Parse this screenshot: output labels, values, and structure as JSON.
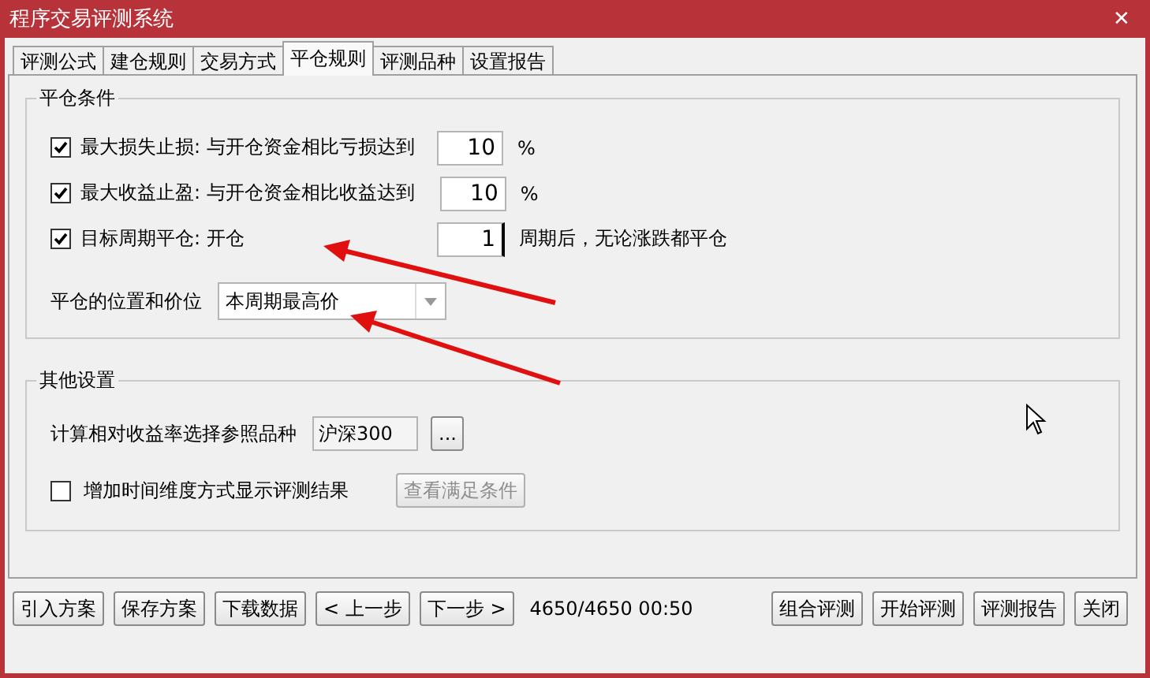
{
  "window": {
    "title": "程序交易评测系统",
    "close": "✕"
  },
  "tabs": [
    {
      "label": "评测公式",
      "selected": false
    },
    {
      "label": "建仓规则",
      "selected": false
    },
    {
      "label": "交易方式",
      "selected": false
    },
    {
      "label": "平仓规则",
      "selected": true
    },
    {
      "label": "评测品种",
      "selected": false
    },
    {
      "label": "设置报告",
      "selected": false
    }
  ],
  "exit_conditions": {
    "title": "平仓条件",
    "rows": [
      {
        "kind": "checkbox",
        "checked": true,
        "label": "最大损失止损: 与开仓资金相比亏损达到",
        "value": "10",
        "unit": "%"
      },
      {
        "kind": "checkbox",
        "checked": true,
        "label": "最大收益止盈: 与开仓资金相比收益达到",
        "value": "10",
        "unit": "%"
      },
      {
        "kind": "checkbox",
        "checked": true,
        "label": "目标周期平仓: 开仓",
        "value": "1",
        "unit": "周期后，无论涨跌都平仓"
      },
      {
        "kind": "dropdown",
        "label": "平仓的位置和价位",
        "value": "本周期最高价"
      }
    ]
  },
  "other_settings": {
    "title": "其他设置",
    "reference": {
      "label": "计算相对收益率选择参照品种",
      "value": "沪深300",
      "button": "..."
    },
    "time_dimension": {
      "checked": false,
      "label": "增加时间维度方式显示评测结果",
      "button": "查看满足条件",
      "disabled": true
    }
  },
  "left_buttons": [
    "引入方案",
    "保存方案",
    "下载数据",
    "< 上一步",
    "下一步 >"
  ],
  "status": "4650/4650 00:50",
  "right_buttons": [
    "组合评测",
    "开始评测",
    "评测报告",
    "关闭"
  ]
}
